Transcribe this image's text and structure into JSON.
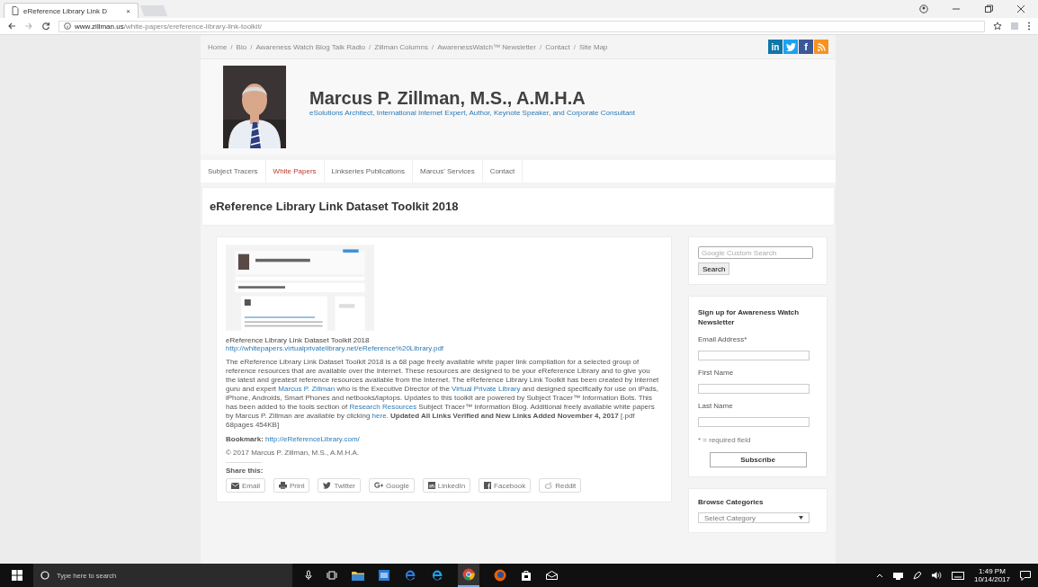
{
  "browser": {
    "tabs": [
      {
        "title": "eReference Library Link D",
        "close": "×",
        "selected": true
      }
    ],
    "url_host": "www.zillman.us",
    "url_path": "/white-papers/ereference-library-link-toolkit/"
  },
  "breadcrumb": [
    {
      "label": "Home"
    },
    {
      "sep": "/",
      "label": "Bio"
    },
    {
      "sep": "/",
      "label": "Awareness Watch Blog Talk Radio"
    },
    {
      "sep": "/",
      "label": "Zillman Columns"
    },
    {
      "sep": "/",
      "label": "AwarenessWatch™ Newsletter"
    },
    {
      "sep": "/",
      "label": "Contact"
    },
    {
      "sep": "/",
      "label": "Site Map"
    }
  ],
  "social": [
    {
      "kind": "linkedin",
      "glyph": "in",
      "color": "#0e76a8"
    },
    {
      "kind": "twitter",
      "color": "#1da1f2"
    },
    {
      "kind": "facebook",
      "glyph": "f",
      "color": "#3b5998"
    },
    {
      "kind": "rss",
      "color": "#f7931e"
    }
  ],
  "site": {
    "name": "Marcus P. Zillman, M.S., A.M.H.A",
    "tagline": "eSolutions Architect, International Internet Expert, Author, Keynote Speaker, and Corporate Consultant"
  },
  "nav": [
    {
      "label": "Subject Tracers",
      "selected": false
    },
    {
      "label": "White Papers",
      "selected": true
    },
    {
      "label": "Linkseries Publications",
      "selected": false
    },
    {
      "label": "Marcus' Services",
      "selected": false
    },
    {
      "label": "Contact",
      "selected": false
    }
  ],
  "page_title": "eReference Library Link Dataset Toolkit 2018",
  "article": {
    "caption": "eReference Library Link Dataset Toolkit 2018",
    "pdf_link": "http://whitepapers.virtualprivatelibrary.net/eReference%20Library.pdf",
    "paragraph": [
      {
        "kind": "text",
        "text": "The eReference Library Link Dataset Toolkit 2018 is a 68 page freely available white paper link compilation for a selected group of reference resources that are available over the Internet. These resources are designed to be your eReference Library and to give you the latest and greatest reference resources available from the Internet. The eReference Library Link Toolkit has been created by Internet guru and expert "
      },
      {
        "kind": "link",
        "text": "Marcus P. Zillman"
      },
      {
        "kind": "text",
        "text": " who is the Executive Director of the "
      },
      {
        "kind": "link",
        "text": "Virtual Private Library"
      },
      {
        "kind": "text",
        "text": " and designed specifically for use on iPads, iPhone, Androids, Smart Phones and netbooks/laptops. Updates to this toolkit are powered by Subject Tracer™ Information Bots. This has been added to the tools section of "
      },
      {
        "kind": "link",
        "text": "Research Resources"
      },
      {
        "kind": "text",
        "text": " Subject Tracer™ Information Blog. Additional freely available white papers by Marcus P. Zillman are available by clicking "
      },
      {
        "kind": "link",
        "text": "here"
      },
      {
        "kind": "text",
        "text": ". **Updated  All Links Verified and New Links Added November 4, 2017**  [.pdf 68pages 454KB]"
      }
    ],
    "bookmark_label": "Bookmark:",
    "bookmark_url": "http://eReferenceLibrary.com/",
    "copyright": "© 2017 Marcus P. Zillman, M.S., A.M.H.A.",
    "share_title": "Share this:",
    "share": [
      {
        "kind": "email",
        "label": "Email"
      },
      {
        "kind": "print",
        "label": "Print"
      },
      {
        "kind": "twitter",
        "label": "Twitter"
      },
      {
        "kind": "google",
        "label": "Google"
      },
      {
        "kind": "linkedin",
        "label": "LinkedIn"
      },
      {
        "kind": "facebook",
        "label": "Facebook"
      },
      {
        "kind": "reddit",
        "label": "Reddit"
      }
    ]
  },
  "sidebar": {
    "search": {
      "placeholder": "Google Custom Search",
      "button": "Search"
    },
    "newsletter": {
      "title": "Sign up for Awareness Watch Newsletter",
      "fields": [
        "Email Address*",
        "First Name",
        "Last Name"
      ],
      "note": "* = required field",
      "button": "Subscribe"
    },
    "categories": {
      "title": "Browse Categories",
      "select": "Select Category"
    }
  },
  "taskbar": {
    "search_placeholder": "Type here to search",
    "time": "1:49 PM",
    "date": "10/14/2017"
  }
}
